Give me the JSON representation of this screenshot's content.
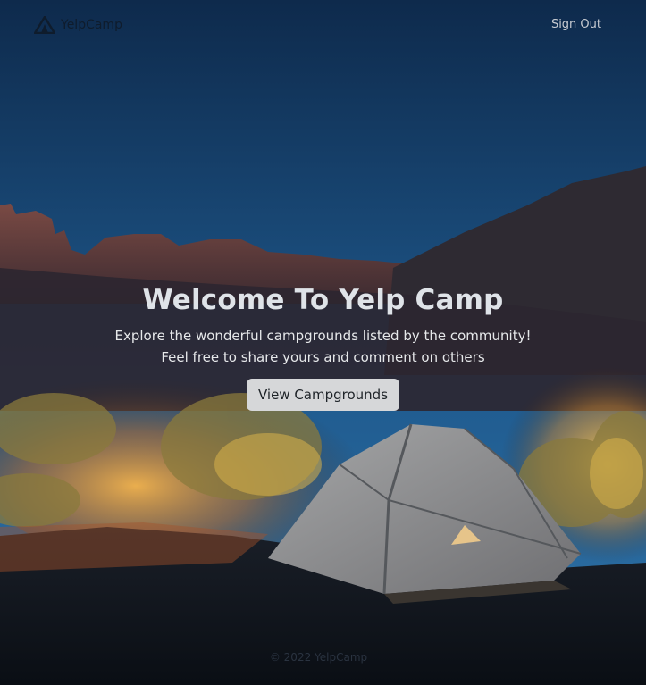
{
  "header": {
    "brand": "YelpCamp",
    "brand_icon": "tent-icon",
    "sign_out": "Sign Out"
  },
  "hero": {
    "title": "Welcome To Yelp Camp",
    "subtitle_line1": "Explore the wonderful campgrounds listed by the community!",
    "subtitle_line2": "Feel free to share yours and comment on others",
    "button": "View Campgrounds"
  },
  "footer": {
    "copyright": "© 2022 YelpCamp"
  },
  "colors": {
    "sky_top": "#0f2c4f",
    "sky_bottom": "#2b6aa0",
    "glow": "#f2a83a",
    "tent": "#8e8f91"
  }
}
